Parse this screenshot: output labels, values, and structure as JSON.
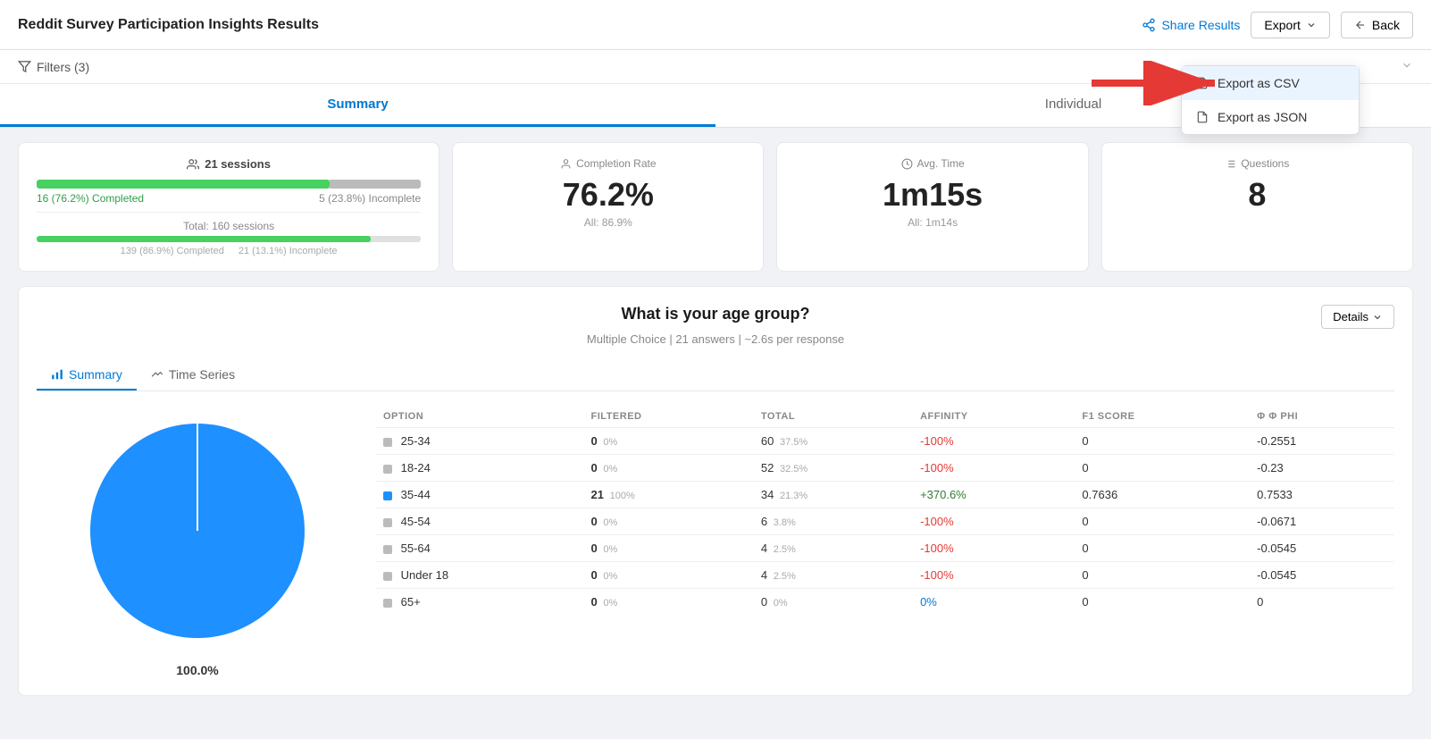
{
  "header": {
    "title": "Reddit Survey Participation Insights Results",
    "share_label": "Share Results",
    "export_label": "Export",
    "back_label": "Back",
    "export_dropdown": [
      {
        "id": "csv",
        "label": "Export as CSV",
        "highlighted": true
      },
      {
        "id": "json",
        "label": "Export as JSON",
        "highlighted": false
      }
    ]
  },
  "filters": {
    "label": "Filters (3)"
  },
  "tabs": [
    {
      "id": "summary",
      "label": "Summary",
      "active": true
    },
    {
      "id": "individual",
      "label": "Individual",
      "active": false
    }
  ],
  "stats": {
    "sessions": {
      "title": "21 sessions",
      "completed_label": "16 (76.2%) Completed",
      "incomplete_label": "5 (23.8%) Incomplete",
      "completed_pct": 76.2,
      "incomplete_pct": 23.8,
      "total_label": "Total: 160 sessions",
      "total_completed_label": "139 (86.9%) Completed",
      "total_incomplete_label": "21 (13.1%) Incomplete"
    },
    "completion_rate": {
      "label": "Completion Rate",
      "value": "76.2%",
      "sub": "All: 86.9%"
    },
    "avg_time": {
      "label": "Avg. Time",
      "value": "1m15s",
      "sub": "All: 1m14s"
    },
    "questions": {
      "label": "Questions",
      "value": "8"
    }
  },
  "question": {
    "title": "What is your age group?",
    "meta": "Multiple Choice | 21 answers | ~2.6s per response",
    "details_label": "Details",
    "sub_tabs": [
      {
        "id": "summary",
        "label": "Summary",
        "active": true,
        "icon": "bar-chart"
      },
      {
        "id": "timeseries",
        "label": "Time Series",
        "active": false,
        "icon": "trend"
      }
    ],
    "pie_label": "100.0%",
    "table_headers": [
      "OPTION",
      "FILTERED",
      "TOTAL",
      "AFFINITY",
      "F1 SCORE",
      "Φ PHI"
    ],
    "table_rows": [
      {
        "option": "25-34",
        "color": "#bbb",
        "filtered": "0",
        "filtered_pct": "0%",
        "total": "60",
        "total_pct": "37.5%",
        "affinity": "-100%",
        "affinity_type": "negative",
        "f1": "0",
        "phi": "-0.2551"
      },
      {
        "option": "18-24",
        "color": "#bbb",
        "filtered": "0",
        "filtered_pct": "0%",
        "total": "52",
        "total_pct": "32.5%",
        "affinity": "-100%",
        "affinity_type": "negative",
        "f1": "0",
        "phi": "-0.23"
      },
      {
        "option": "35-44",
        "color": "#1e90ff",
        "filtered": "21",
        "filtered_pct": "100%",
        "total": "34",
        "total_pct": "21.3%",
        "affinity": "+370.6%",
        "affinity_type": "positive",
        "f1": "0.7636",
        "phi": "0.7533"
      },
      {
        "option": "45-54",
        "color": "#bbb",
        "filtered": "0",
        "filtered_pct": "0%",
        "total": "6",
        "total_pct": "3.8%",
        "affinity": "-100%",
        "affinity_type": "negative",
        "f1": "0",
        "phi": "-0.0671"
      },
      {
        "option": "55-64",
        "color": "#bbb",
        "filtered": "0",
        "filtered_pct": "0%",
        "total": "4",
        "total_pct": "2.5%",
        "affinity": "-100%",
        "affinity_type": "negative",
        "f1": "0",
        "phi": "-0.0545"
      },
      {
        "option": "Under 18",
        "color": "#bbb",
        "filtered": "0",
        "filtered_pct": "0%",
        "total": "4",
        "total_pct": "2.5%",
        "affinity": "-100%",
        "affinity_type": "negative",
        "f1": "0",
        "phi": "-0.0545"
      },
      {
        "option": "65+",
        "color": "#bbb",
        "filtered": "0",
        "filtered_pct": "0%",
        "total": "0",
        "total_pct": "0%",
        "affinity": "0%",
        "affinity_type": "zero",
        "f1": "0",
        "phi": "0"
      }
    ]
  }
}
